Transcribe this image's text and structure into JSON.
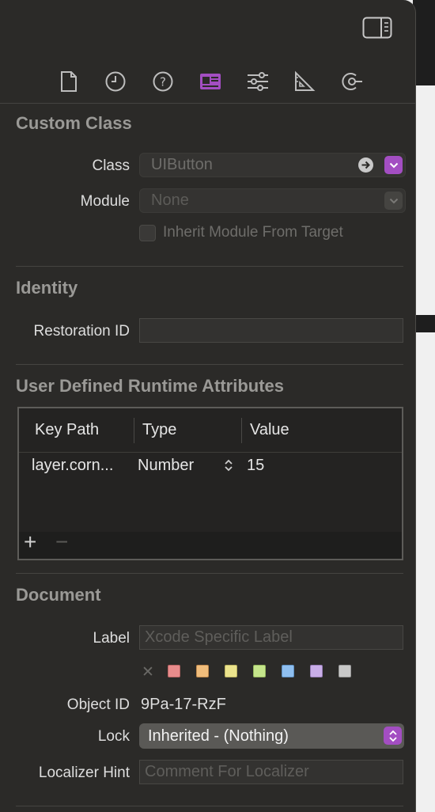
{
  "tabs": [
    {
      "name": "file-inspector",
      "icon": "document-icon"
    },
    {
      "name": "history-inspector",
      "icon": "clock-icon"
    },
    {
      "name": "quick-help-inspector",
      "icon": "question-mark-icon"
    },
    {
      "name": "identity-inspector",
      "icon": "identity-card-icon",
      "active": true
    },
    {
      "name": "attributes-inspector",
      "icon": "sliders-icon"
    },
    {
      "name": "size-inspector",
      "icon": "ruler-triangle-icon"
    },
    {
      "name": "connections-inspector",
      "icon": "connection-arrow-icon"
    }
  ],
  "custom_class": {
    "title": "Custom Class",
    "class_label": "Class",
    "class_placeholder": "UIButton",
    "module_label": "Module",
    "module_placeholder": "None",
    "inherit_label": "Inherit Module From Target"
  },
  "identity": {
    "title": "Identity",
    "restoration_label": "Restoration ID",
    "restoration_value": ""
  },
  "runtime_attributes": {
    "title": "User Defined Runtime Attributes",
    "headers": [
      "Key Path",
      "Type",
      "Value"
    ],
    "rows": [
      {
        "key_path": "layer.corn...",
        "type": "Number",
        "value": "15"
      }
    ],
    "add_symbol": "+",
    "remove_symbol": "−"
  },
  "document": {
    "title": "Document",
    "label_label": "Label",
    "label_placeholder": "Xcode Specific Label",
    "clear_symbol": "✕",
    "swatches": [
      "#e88c8c",
      "#f0bd7c",
      "#ebe38c",
      "#c5e58b",
      "#8fbff0",
      "#c9aee8",
      "#c8c8c8"
    ],
    "object_id_label": "Object ID",
    "object_id_value": "9Pa-17-RzF",
    "lock_label": "Lock",
    "lock_value": "Inherited - (Nothing)",
    "localizer_label": "Localizer Hint",
    "localizer_placeholder": "Comment For Localizer"
  },
  "colors": {
    "accent": "#a34ec2",
    "panel_bg": "#2b2a28"
  }
}
